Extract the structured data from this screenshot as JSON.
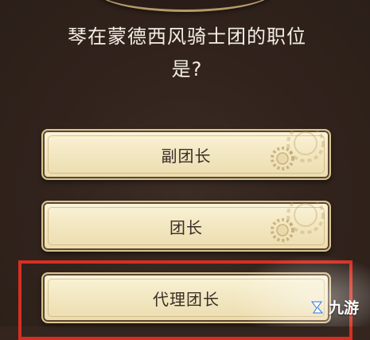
{
  "question": {
    "line1": "琴在蒙德西风骑士团的职位",
    "line2": "是?"
  },
  "options": [
    {
      "label": "副团长"
    },
    {
      "label": "团长"
    },
    {
      "label": "代理团长"
    }
  ],
  "watermark": {
    "text": "九游"
  },
  "colors": {
    "background": "#34261f",
    "option_fill": "#f3e8c2",
    "highlight_frame": "#d62f22",
    "question_text": "#f4efe6"
  }
}
